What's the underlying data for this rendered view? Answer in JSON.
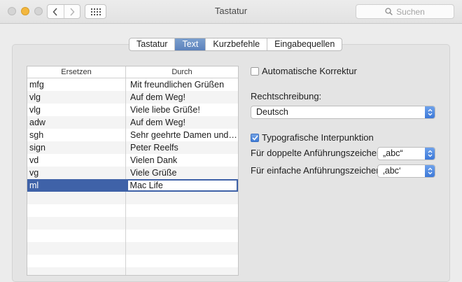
{
  "window": {
    "title": "Tastatur",
    "search_placeholder": "Suchen"
  },
  "tabs": [
    {
      "label": "Tastatur",
      "active": false
    },
    {
      "label": "Text",
      "active": true
    },
    {
      "label": "Kurzbefehle",
      "active": false
    },
    {
      "label": "Eingabequellen",
      "active": false
    }
  ],
  "table": {
    "headers": [
      "Ersetzen",
      "Durch"
    ],
    "rows": [
      {
        "replace": "mfg",
        "with": "Mit freundlichen Grüßen"
      },
      {
        "replace": "vlg",
        "with": "Auf dem Weg!"
      },
      {
        "replace": "vlg",
        "with": "Viele liebe Grüße!"
      },
      {
        "replace": "adw",
        "with": "Auf dem Weg!"
      },
      {
        "replace": "sgh",
        "with": "Sehr geehrte Damen und…"
      },
      {
        "replace": "sign",
        "with": "Peter Reelfs"
      },
      {
        "replace": "vd",
        "with": "Vielen Dank"
      },
      {
        "replace": "vg",
        "with": "Viele Grüße"
      },
      {
        "replace": "ml",
        "with": "Mac Life",
        "selected": true
      }
    ],
    "empty_rows": 7
  },
  "settings": {
    "auto_correct": {
      "label": "Automatische Korrektur",
      "checked": false
    },
    "spelling": {
      "label": "Rechtschreibung:",
      "value": "Deutsch"
    },
    "smart_quotes": {
      "label": "Typografische Interpunktion",
      "checked": true
    },
    "double_quotes": {
      "label": "Für doppelte Anführungszeichen",
      "value": "„abc“"
    },
    "single_quotes": {
      "label": "Für einfache Anführungszeichen",
      "value": "‚abc‘"
    }
  },
  "colors": {
    "accent": "#3f62a8",
    "popup_arrow": "#3c78d8",
    "minimize": "#f3b73f"
  }
}
